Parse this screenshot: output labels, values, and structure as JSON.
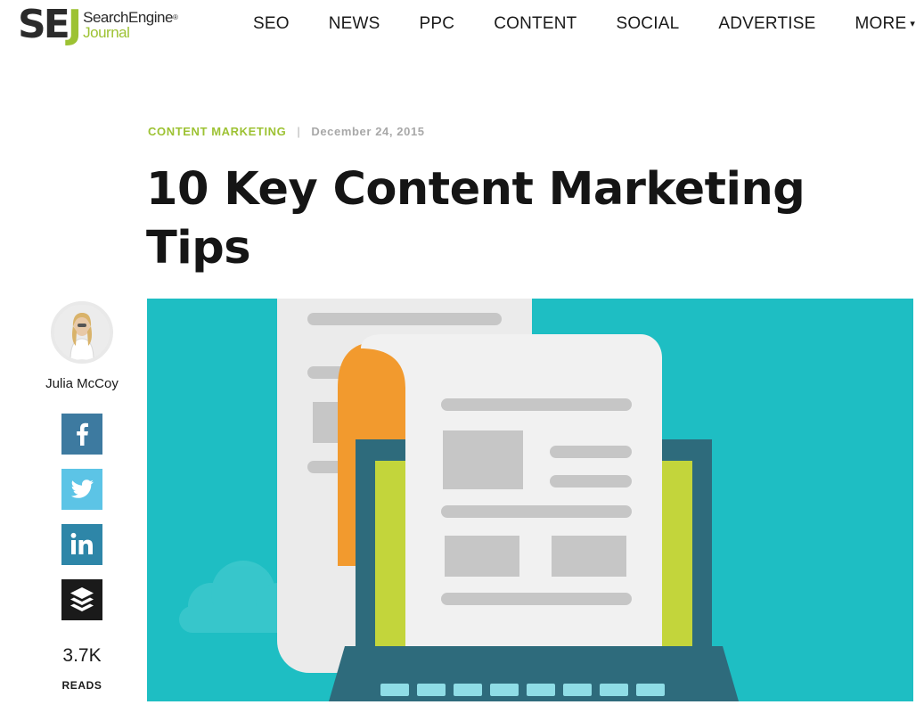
{
  "logo": {
    "mark_se": "SE",
    "mark_j": "J",
    "line1": "SearchEngine",
    "registered": "®",
    "line2": "Journal"
  },
  "nav": {
    "items": [
      "SEO",
      "NEWS",
      "PPC",
      "CONTENT",
      "SOCIAL",
      "ADVERTISE",
      "MORE"
    ],
    "more_caret": "▾"
  },
  "article": {
    "category": "CONTENT MARKETING",
    "separator": "|",
    "date": "December 24, 2015",
    "title": "10 Key Content Marketing Tips"
  },
  "sidebar": {
    "author": "Julia McCoy",
    "share_icons": [
      "facebook-icon",
      "twitter-icon",
      "linkedin-icon",
      "buffer-icon"
    ],
    "reads_count": "3.7K",
    "reads_label": "READS"
  },
  "colors": {
    "brand_green": "#9dc233",
    "hero_teal": "#1ebec3",
    "laptop_frame": "#2e6b7c",
    "screen_lime": "#c3d53b",
    "paper_orange": "#f29a2e",
    "facebook": "#3d7aa0",
    "twitter": "#5cc4e6",
    "linkedin": "#2e86a8",
    "buffer": "#1a1a1a"
  }
}
